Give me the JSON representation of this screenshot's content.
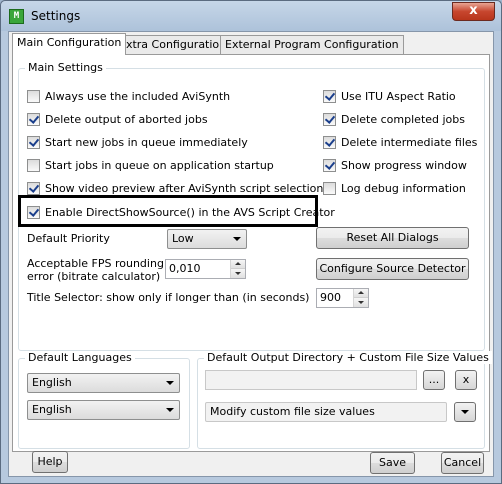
{
  "window": {
    "title": "Settings",
    "close_glyph": "x"
  },
  "tabs": [
    {
      "label": "Main Configuration",
      "active": true
    },
    {
      "label": "Extra Configuration",
      "active": false
    },
    {
      "label": "External Program Configuration",
      "active": false
    }
  ],
  "main_settings": {
    "title": "Main Settings",
    "left_checks": [
      {
        "label": "Always use the included AviSynth",
        "checked": false
      },
      {
        "label": "Delete output of aborted jobs",
        "checked": true
      },
      {
        "label": "Start new jobs in queue immediately",
        "checked": true
      },
      {
        "label": "Start jobs in queue on application startup",
        "checked": false
      },
      {
        "label": "Show video preview after AviSynth script selection",
        "checked": true
      },
      {
        "label": "Enable DirectShowSource() in the AVS Script Creator",
        "checked": true
      }
    ],
    "right_checks": [
      {
        "label": "Use ITU Aspect Ratio",
        "checked": true
      },
      {
        "label": "Delete completed jobs",
        "checked": true
      },
      {
        "label": "Delete intermediate files",
        "checked": true
      },
      {
        "label": "Show progress window",
        "checked": true
      },
      {
        "label": "Log debug information",
        "checked": false
      }
    ],
    "default_priority_label": "Default Priority",
    "default_priority_value": "Low",
    "fps_rounding_label_1": "Acceptable FPS rounding",
    "fps_rounding_label_2": "error (bitrate calculator)",
    "fps_rounding_value": "0,010",
    "title_selector_label": "Title Selector:  show only if longer than (in seconds)",
    "title_selector_value": "900",
    "reset_all_dialogs": "Reset All Dialogs",
    "configure_source_detector": "Configure Source Detector"
  },
  "default_languages": {
    "title": "Default Languages",
    "lang1": "English",
    "lang2": "English"
  },
  "output_dir": {
    "title": "Default Output Directory + Custom File Size Values",
    "browse_label": "...",
    "clear_label": "x",
    "custom_size_value": "Modify custom file size values"
  },
  "footer": {
    "help": "Help",
    "save": "Save",
    "cancel": "Cancel"
  }
}
